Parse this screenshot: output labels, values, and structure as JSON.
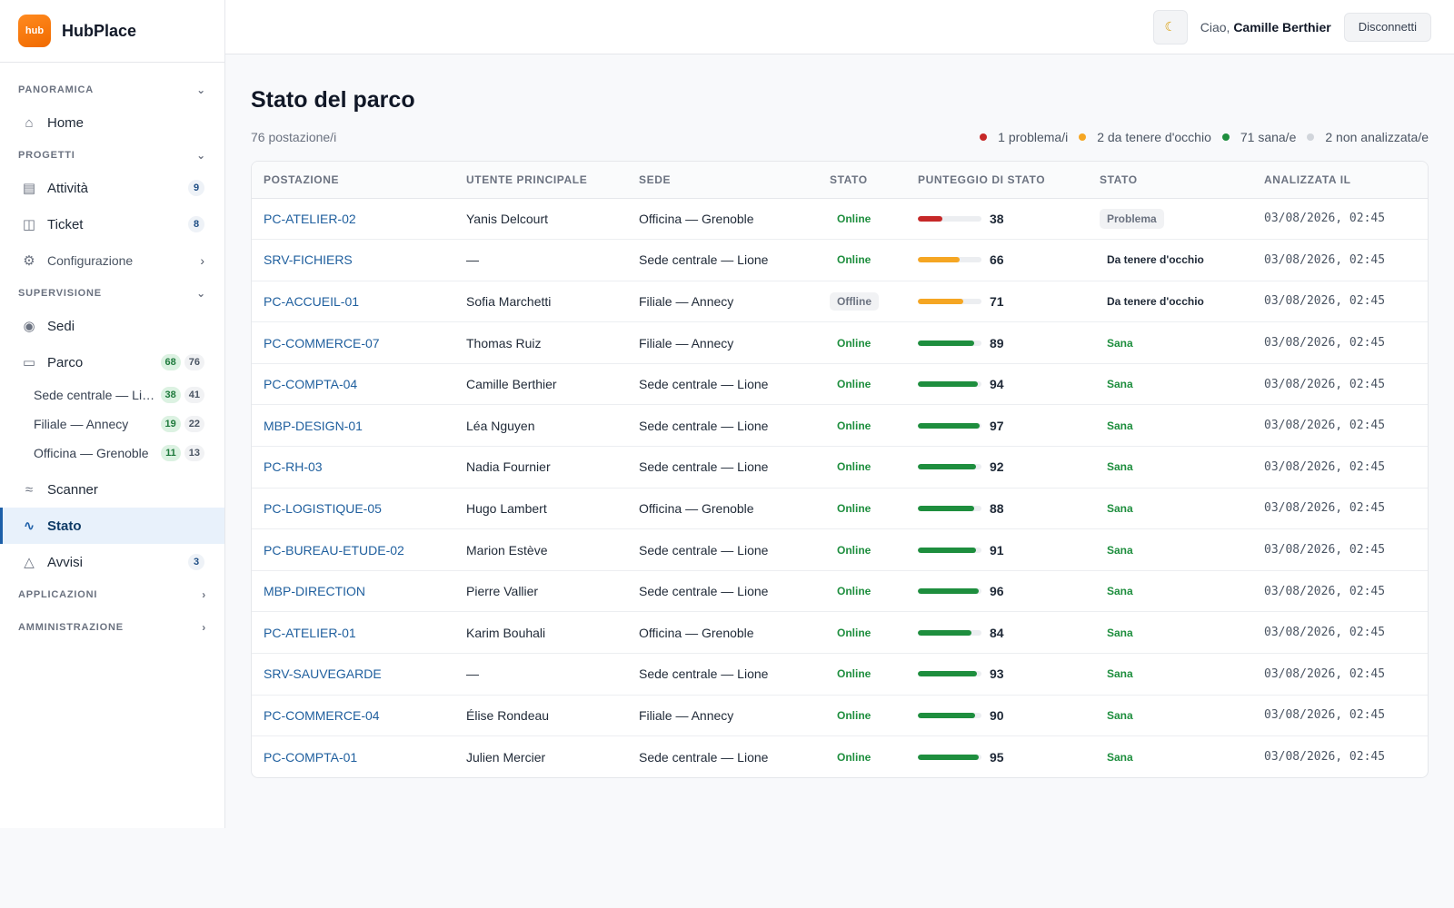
{
  "brand": {
    "logo_text": "hub",
    "name": "HubPlace"
  },
  "sidebar": {
    "sections": {
      "panoramica": "PANORAMICA",
      "progetti": "PROGETTI",
      "supervisione": "SUPERVISIONE",
      "applicazioni": "APPLICAZIONI",
      "amministrazione": "AMMINISTRAZIONE"
    },
    "home": "Home",
    "attivita": {
      "label": "Attività",
      "count": "9"
    },
    "ticket": {
      "label": "Ticket",
      "count": "8"
    },
    "configurazione": "Configurazione",
    "sedi": "Sedi",
    "parco": {
      "label": "Parco",
      "online": "68",
      "total": "76"
    },
    "sub_sites": [
      {
        "label": "Sede centrale — Lione",
        "online": "38",
        "total": "41"
      },
      {
        "label": "Filiale — Annecy",
        "online": "19",
        "total": "22"
      },
      {
        "label": "Officina — Grenoble",
        "online": "11",
        "total": "13"
      }
    ],
    "scanner": "Scanner",
    "stato": "Stato",
    "avvisi": {
      "label": "Avvisi",
      "count": "3"
    }
  },
  "topbar": {
    "theme_icon": "moon-icon",
    "greeting_prefix": "Ciao,",
    "user_name": "Camille Berthier",
    "logout_label": "Disconnetti"
  },
  "page": {
    "title": "Stato del parco",
    "count_label": "76 postazione/i",
    "legend": [
      {
        "label": "1 problema/i",
        "color": "#c62828"
      },
      {
        "label": "2 da tenere d'occhio",
        "color": "#f5a623"
      },
      {
        "label": "71 sana/e",
        "color": "#1e8e3e"
      },
      {
        "label": "2 non analizzata/e",
        "color": "#d1d5db"
      }
    ]
  },
  "table": {
    "headers": [
      "POSTAZIONE",
      "UTENTE PRINCIPALE",
      "SEDE",
      "STATO",
      "PUNTEGGIO DI STATO",
      "STATO",
      "ANALIZZATA IL"
    ],
    "rows": [
      {
        "host": "PC-ATELIER-02",
        "user": "Yanis Delcourt",
        "site": "Officina — Grenoble",
        "conn": "Online",
        "score": 38,
        "status": "Problema",
        "level": "problem",
        "date": "03/08/2026, 02:45"
      },
      {
        "host": "SRV-FICHIERS",
        "user": "—",
        "site": "Sede centrale — Lione",
        "conn": "Online",
        "score": 66,
        "status": "Da tenere d'occhio",
        "level": "watch",
        "date": "03/08/2026, 02:45"
      },
      {
        "host": "PC-ACCUEIL-01",
        "user": "Sofia Marchetti",
        "site": "Filiale — Annecy",
        "conn": "Offline",
        "score": 71,
        "status": "Da tenere d'occhio",
        "level": "watch",
        "date": "03/08/2026, 02:45"
      },
      {
        "host": "PC-COMMERCE-07",
        "user": "Thomas Ruiz",
        "site": "Filiale — Annecy",
        "conn": "Online",
        "score": 89,
        "status": "Sana",
        "level": "ok",
        "date": "03/08/2026, 02:45"
      },
      {
        "host": "PC-COMPTA-04",
        "user": "Camille Berthier",
        "site": "Sede centrale — Lione",
        "conn": "Online",
        "score": 94,
        "status": "Sana",
        "level": "ok",
        "date": "03/08/2026, 02:45"
      },
      {
        "host": "MBP-DESIGN-01",
        "user": "Léa Nguyen",
        "site": "Sede centrale — Lione",
        "conn": "Online",
        "score": 97,
        "status": "Sana",
        "level": "ok",
        "date": "03/08/2026, 02:45"
      },
      {
        "host": "PC-RH-03",
        "user": "Nadia Fournier",
        "site": "Sede centrale — Lione",
        "conn": "Online",
        "score": 92,
        "status": "Sana",
        "level": "ok",
        "date": "03/08/2026, 02:45"
      },
      {
        "host": "PC-LOGISTIQUE-05",
        "user": "Hugo Lambert",
        "site": "Officina — Grenoble",
        "conn": "Online",
        "score": 88,
        "status": "Sana",
        "level": "ok",
        "date": "03/08/2026, 02:45"
      },
      {
        "host": "PC-BUREAU-ETUDE-02",
        "user": "Marion Estève",
        "site": "Sede centrale — Lione",
        "conn": "Online",
        "score": 91,
        "status": "Sana",
        "level": "ok",
        "date": "03/08/2026, 02:45"
      },
      {
        "host": "MBP-DIRECTION",
        "user": "Pierre Vallier",
        "site": "Sede centrale — Lione",
        "conn": "Online",
        "score": 96,
        "status": "Sana",
        "level": "ok",
        "date": "03/08/2026, 02:45"
      },
      {
        "host": "PC-ATELIER-01",
        "user": "Karim Bouhali",
        "site": "Officina — Grenoble",
        "conn": "Online",
        "score": 84,
        "status": "Sana",
        "level": "ok",
        "date": "03/08/2026, 02:45"
      },
      {
        "host": "SRV-SAUVEGARDE",
        "user": "—",
        "site": "Sede centrale — Lione",
        "conn": "Online",
        "score": 93,
        "status": "Sana",
        "level": "ok",
        "date": "03/08/2026, 02:45"
      },
      {
        "host": "PC-COMMERCE-04",
        "user": "Élise Rondeau",
        "site": "Filiale — Annecy",
        "conn": "Online",
        "score": 90,
        "status": "Sana",
        "level": "ok",
        "date": "03/08/2026, 02:45"
      },
      {
        "host": "PC-COMPTA-01",
        "user": "Julien Mercier",
        "site": "Sede centrale — Lione",
        "conn": "Online",
        "score": 95,
        "status": "Sana",
        "level": "ok",
        "date": "03/08/2026, 02:45"
      }
    ]
  },
  "colors": {
    "accent": "#1d5fa8",
    "problem": "#c62828",
    "watch": "#f5a623",
    "ok": "#1e8e3e"
  }
}
